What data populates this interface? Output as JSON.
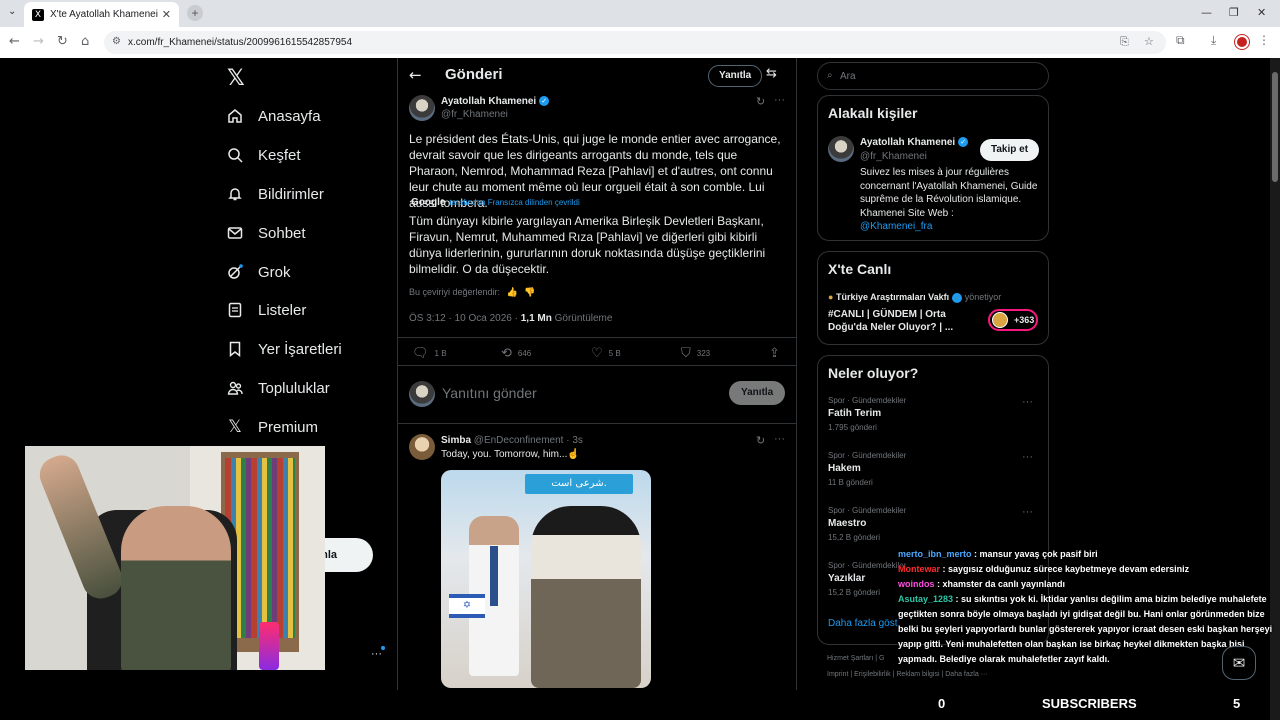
{
  "browser": {
    "tab_title": "X'te Ayatollah Khamenei: \"Le pr",
    "url": "x.com/fr_Khamenei/status/2009961615542857954"
  },
  "nav": {
    "items": [
      {
        "label": "Anasayfa",
        "icon": "home-icon"
      },
      {
        "label": "Keşfet",
        "icon": "search-icon"
      },
      {
        "label": "Bildirimler",
        "icon": "bell-icon"
      },
      {
        "label": "Sohbet",
        "icon": "mail-icon"
      },
      {
        "label": "Grok",
        "icon": "grok-icon"
      },
      {
        "label": "Listeler",
        "icon": "list-icon"
      },
      {
        "label": "Yer İşaretleri",
        "icon": "bookmark-icon"
      },
      {
        "label": "Topluluklar",
        "icon": "people-icon"
      },
      {
        "label": "Premium",
        "icon": "x-icon"
      }
    ],
    "post_button_fragment": "nla"
  },
  "header": {
    "title": "Gönderi",
    "reply_label": "Yanıtla"
  },
  "tweet": {
    "name": "Ayatollah Khamenei",
    "handle": "@fr_Khamenei",
    "text": "Le président des États-Unis, qui juge le monde entier avec arrogance, devrait savoir que les dirigeants arrogants du monde, tels que Pharaon, Nemrod, Mohammad Reza [Pahlavi] et d'autres, ont connu leur chute au moment même où leur orgueil était à son comble. Lui aussi tombera.",
    "translator": "Google",
    "translated_note": "tarafından Fransızca dilinden çevrildi",
    "translation": "Tüm dünyayı kibirle yargılayan Amerika Birleşik Devletleri Başkanı, Firavun, Nemrut, Muhammed Rıza [Pahlavi] ve diğerleri gibi kibirli dünya liderlerinin, gururlarının doruk noktasında düşüşe geçtiklerini bilmelidir. O da düşecektir.",
    "rate_translation": "Bu çeviriyi değerlendir:",
    "time": "ÖS 3:12 · 10 Oca 2026 · ",
    "views": "1,1 Mn",
    "views_label": "Görüntüleme",
    "replies": "1 B",
    "reposts": "646",
    "likes": "5 B",
    "bookmarks": "323"
  },
  "compose": {
    "placeholder": "Yanıtını gönder",
    "button": "Yanıtla"
  },
  "reply": {
    "name": "Simba",
    "meta": "@EnDeconfinement · 3s",
    "text": "Today, you. Tomorrow, him...☝",
    "image_banner": "شرعی است."
  },
  "right": {
    "search_placeholder": "Ara",
    "related_title": "Alakalı kişiler",
    "related": {
      "name": "Ayatollah Khamenei",
      "handle": "@fr_Khamenei",
      "follow": "Takip et",
      "bio": "Suivez les mises à jour régulières concernant l'Ayatollah Khamenei, Guide suprême de la Révolution islamique. Khamenei Site Web :",
      "bio_link": "@Khamenei_fra"
    },
    "live_title": "X'te Canlı",
    "live": {
      "source": "Türkiye Araştırmaları Vakfı",
      "role": "yönetiyor",
      "title": "#CANLI | GÜNDEM | Orta Doğu'da Neler Oluyor? | ...",
      "count": "+363"
    },
    "trends_title": "Neler oluyor?",
    "trends": [
      {
        "context": "Spor · Gündemdekiler",
        "name": "Fatih Terim",
        "posts": "1.795 gönderi"
      },
      {
        "context": "Spor · Gündemdekiler",
        "name": "Hakem",
        "posts": "11 B gönderi"
      },
      {
        "context": "Spor · Gündemdekiler",
        "name": "Maestro",
        "posts": "15,2 B gönderi"
      },
      {
        "context": "Spor · Gündemdekiler",
        "name": "Yazıklar",
        "posts": "15,2 B gönderi"
      }
    ],
    "show_more": "Daha fazla göst",
    "footer1": "Hizmet Şartları  |  G",
    "footer2": "Imprint  |  Erişilebilirlik  |  Reklam bilgisi  |  Daha fazla ···"
  },
  "chat": [
    {
      "user": "merto_ibn_merto",
      "msg": " : mansur yavaş çok pasif biri"
    },
    {
      "user": "Montewar",
      "msg": " : saygısız olduğunuz sürece kaybetmeye devam edersiniz"
    },
    {
      "user": "woindos",
      "msg": " : xhamster da canlı yayınlandı"
    },
    {
      "user": "Asutay_1283",
      "msg": " : su sıkıntısı yok ki. İktidar yanlısı değilim ama bizim belediye muhalefete geçtikten sonra böyle olmaya başladı iyi gidişat değil bu. Hani onlar görünmeden bize belki bu şeyleri yapıyorlardı bunlar göstererek yapıyor icraat desen eski başkan herşeyi yapıp gitti. Yeni muhalefetten olan başkan ise birkaç heykel dikmekten başka bişi yapmadı. Belediye olarak muhalefetler zayıf kaldı."
    }
  ],
  "overlay": {
    "left": "0",
    "label": "SUBSCRIBERS",
    "right": "5"
  }
}
